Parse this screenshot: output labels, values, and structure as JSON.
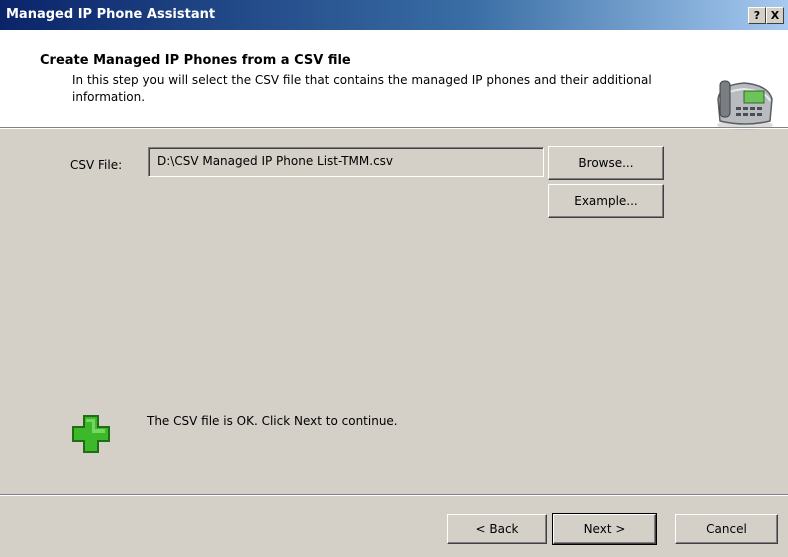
{
  "window": {
    "title": "Managed IP Phone Assistant",
    "help_button": "?",
    "close_button": "X"
  },
  "header": {
    "title": "Create Managed IP Phones from a CSV file",
    "description": "In this step you will select the CSV file that contains the managed IP phones and their additional information.",
    "icon": "telephone-icon"
  },
  "form": {
    "csv_label": "CSV File:",
    "csv_value": "D:\\CSV Managed IP Phone List-TMM.csv",
    "browse_label": "Browse...",
    "example_label": "Example..."
  },
  "status": {
    "icon": "green-plus-icon",
    "text": "The CSV file is OK.  Click Next to continue."
  },
  "footer": {
    "back_label": "< Back",
    "next_label": "Next >",
    "cancel_label": "Cancel"
  },
  "colors": {
    "titlebar_start": "#0a246a",
    "titlebar_end": "#a6caf0",
    "dialog_bg": "#d4d0c8",
    "header_bg": "#ffffff",
    "ok_icon_green": "#3cb82a"
  }
}
